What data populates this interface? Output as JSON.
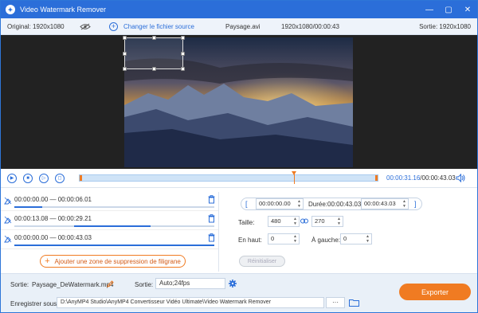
{
  "window": {
    "title": "Video Watermark Remover",
    "controls": [
      "—",
      "▢",
      "✕"
    ]
  },
  "infobar": {
    "original": "Original: 1920x1080",
    "change_source": "Changer le fichier source",
    "filename": "Paysage.avi",
    "resolution_duration": "1920x1080/00:00:43",
    "output": "Sortie: 1920x1080"
  },
  "player": {
    "current_time": "00:00:31.16",
    "total_time": "/00:00:43.03",
    "playhead_position": 0.72
  },
  "segments": [
    {
      "range": "00:00:00.00 — 00:00:06.01",
      "fill": [
        0.0,
        0.14
      ]
    },
    {
      "range": "00:00:13.08 — 00:00:29.21",
      "fill": [
        0.3,
        0.68
      ]
    },
    {
      "range": "00:00:00.00 — 00:00:43.03",
      "fill": [
        0.0,
        1.0
      ]
    }
  ],
  "add_zone_label": "Ajouter une zone de suppression de filigrane",
  "settings": {
    "start": "00:00:00.00",
    "duration_label": "Durée:",
    "duration": "00:00:43.03",
    "end": "00:00:43.03",
    "size_label": "Taille:",
    "width": "480",
    "height": "270",
    "top_label": "En haut:",
    "top": "0",
    "left_label": "À gauche:",
    "left": "0",
    "reset_label": "Réinitialiser"
  },
  "bottom": {
    "output_label": "Sortie:",
    "output_file": "Paysage_DeWatermark.mp4",
    "format_label": "Sortie:",
    "format": "Auto;24fps",
    "save_label": "Enregistrer sous:",
    "save_path": "D:\\AnyMP4 Studio\\AnyMP4 Convertisseur Vidéo Ultimate\\Video Watermark Remover",
    "browse": "···",
    "export_label": "Exporter"
  },
  "colors": {
    "accent": "#2b6ed9",
    "export": "#f07b22"
  }
}
